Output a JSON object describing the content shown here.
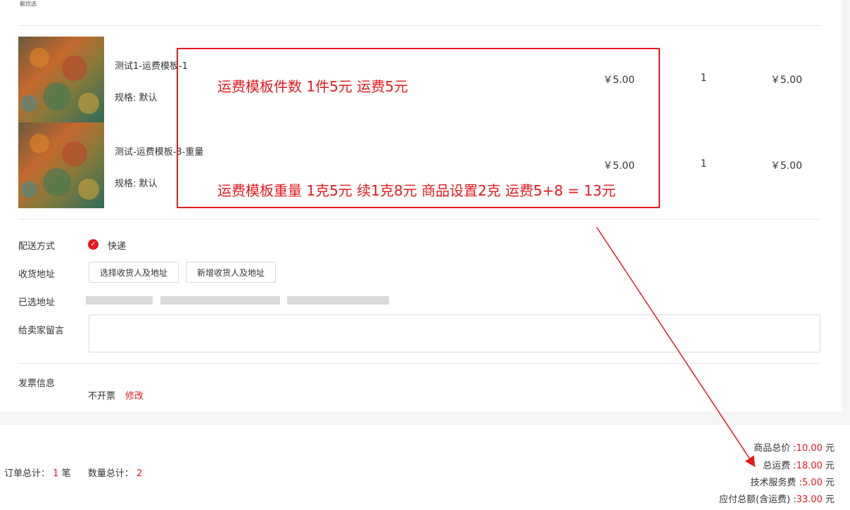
{
  "header": {
    "logo_text": "靓优选"
  },
  "products": [
    {
      "name": "测试1-运费模板-1",
      "spec": "规格: 默认",
      "price": "￥5.00",
      "qty": "1",
      "subtotal": "￥5.00"
    },
    {
      "name": "测试-运费模板-3-重量",
      "spec": "规格: 默认",
      "price": "￥5.00",
      "qty": "1",
      "subtotal": "￥5.00"
    }
  ],
  "annotations": {
    "line1": "运费模板件数 1件5元   运费5元",
    "line2": "运费模板重量 1克5元 续1克8元 商品设置2克 运费5+8 = 13元",
    "color": "#e5191e"
  },
  "form": {
    "delivery_label": "配送方式",
    "delivery_value": "快递",
    "address_label": "收货地址",
    "select_address_btn": "选择收货人及地址",
    "new_address_btn": "新增收货人及地址",
    "selected_address_label": "已选地址",
    "message_label": "给卖家留言",
    "message_value": "",
    "invoice_label": "发票信息",
    "invoice_value": "不开票",
    "invoice_edit": "修改"
  },
  "footer": {
    "order_total_label": "订单总计：",
    "order_total_count": "1",
    "order_total_unit": "笔",
    "qty_total_label": "数量总计：",
    "qty_total_count": "2"
  },
  "summary": {
    "goods_total_label": "商品总价 :",
    "goods_total_value": "10.00",
    "freight_label": "总运费 :",
    "freight_value": "18.00",
    "service_fee_label": "技术服务费 :",
    "service_fee_value": "5.00",
    "payable_label": "应付总额(含运费) :",
    "payable_value": "33.00",
    "unit": "元"
  },
  "colors": {
    "accent": "#e5191e",
    "border": "#d9d9d9",
    "background_gray": "#f5f5f5"
  }
}
